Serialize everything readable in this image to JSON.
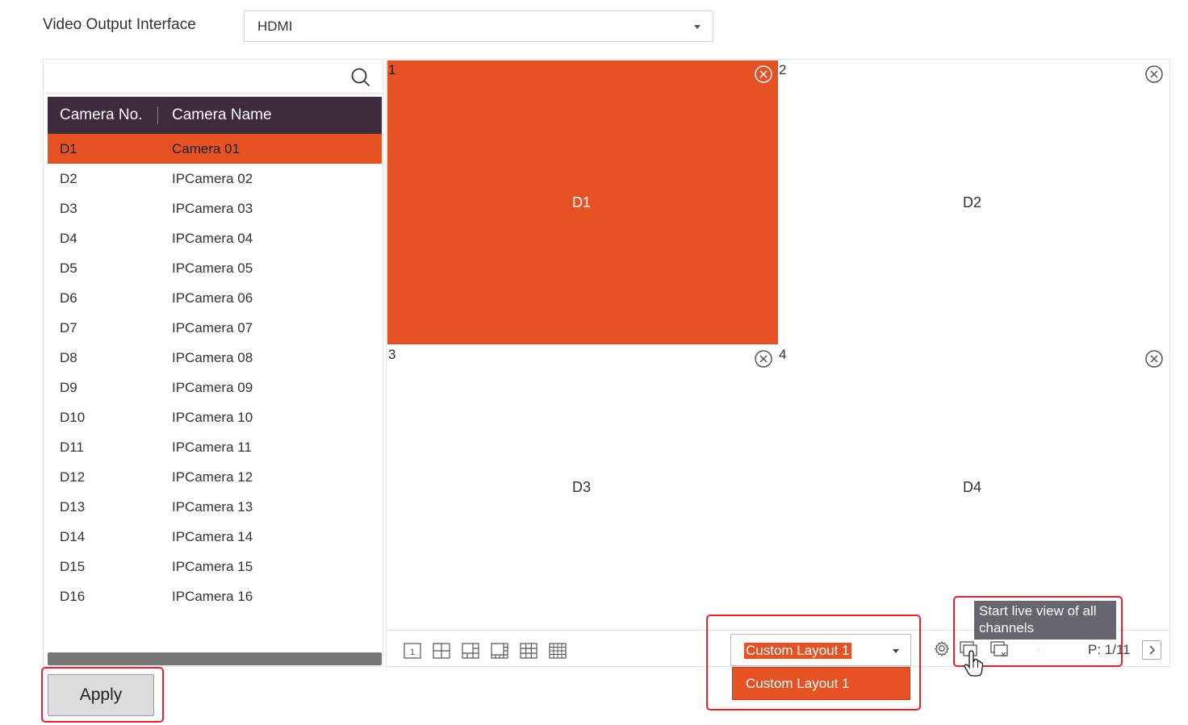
{
  "output": {
    "label": "Video Output Interface",
    "value": "HDMI"
  },
  "camera_table": {
    "col_no": "Camera No.",
    "col_name": "Camera Name",
    "rows": [
      {
        "no": "D1",
        "name": "Camera 01",
        "selected": true
      },
      {
        "no": "D2",
        "name": "IPCamera 02"
      },
      {
        "no": "D3",
        "name": "IPCamera 03"
      },
      {
        "no": "D4",
        "name": "IPCamera 04"
      },
      {
        "no": "D5",
        "name": "IPCamera 05"
      },
      {
        "no": "D6",
        "name": "IPCamera 06"
      },
      {
        "no": "D7",
        "name": "IPCamera 07"
      },
      {
        "no": "D8",
        "name": "IPCamera 08"
      },
      {
        "no": "D9",
        "name": "IPCamera 09"
      },
      {
        "no": "D10",
        "name": "IPCamera 10"
      },
      {
        "no": "D11",
        "name": "IPCamera 11"
      },
      {
        "no": "D12",
        "name": "IPCamera 12"
      },
      {
        "no": "D13",
        "name": "IPCamera 13"
      },
      {
        "no": "D14",
        "name": "IPCamera 14"
      },
      {
        "no": "D15",
        "name": "IPCamera 15"
      },
      {
        "no": "D16",
        "name": "IPCamera 16"
      }
    ]
  },
  "apply_label": "Apply",
  "grid": {
    "cells": [
      {
        "num": "1",
        "cam": "D1",
        "active": true
      },
      {
        "num": "2",
        "cam": "D2"
      },
      {
        "num": "3",
        "cam": "D3"
      },
      {
        "num": "4",
        "cam": "D4"
      }
    ]
  },
  "layout": {
    "selected": "Custom Layout 1",
    "option": "Custom Layout 1"
  },
  "tooltip": "Start live view of all channels",
  "page": "P: 1/11",
  "colors": {
    "accent": "#e65224",
    "header_bg": "#3d2a3c",
    "highlight_box": "#e8202e"
  }
}
